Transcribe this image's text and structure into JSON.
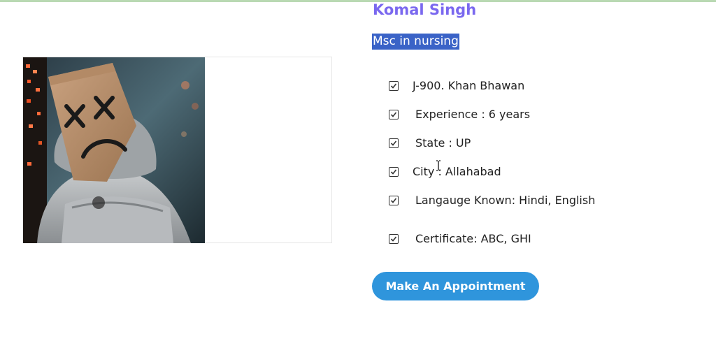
{
  "profile": {
    "name": "Komal Singh",
    "degree": "Msc in nursing",
    "photo_icon": "paper-bag-masked-person-photo"
  },
  "details": [
    {
      "icon": "checkbox-checked-icon",
      "text": "J-900. Khan Bhawan"
    },
    {
      "icon": "checkbox-checked-icon",
      "text": "Experience : 6 years"
    },
    {
      "icon": "checkbox-checked-icon",
      "text": "State : UP"
    },
    {
      "icon": "checkbox-checked-icon",
      "text": "City : Allahabad"
    },
    {
      "icon": "checkbox-checked-icon",
      "text": "Langauge Known: Hindi, English"
    },
    {
      "icon": "checkbox-checked-icon",
      "text": "Certificate: ABC, GHI"
    }
  ],
  "actions": {
    "appointment_label": "Make An Appointment"
  },
  "colors": {
    "name": "#7a68ef",
    "degree_highlight": "#3a63c7",
    "button": "#2f95dc"
  }
}
